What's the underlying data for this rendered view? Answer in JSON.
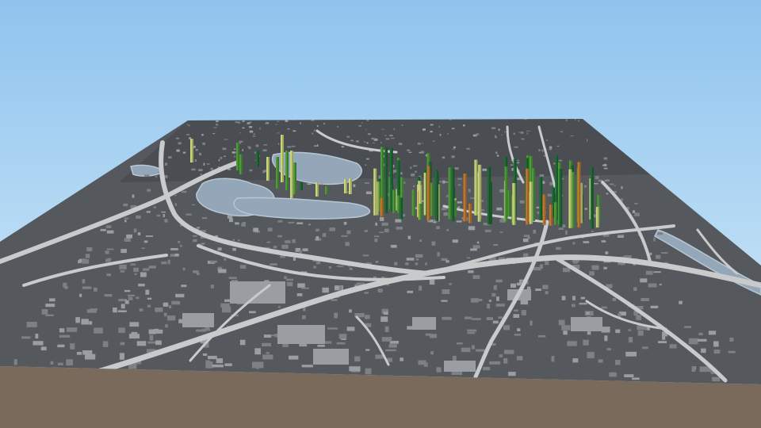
{
  "scene": {
    "colors": {
      "sky_top": "#8fc3ee",
      "sky_bottom": "#d8eef9",
      "ground": "#55595d",
      "ground_dark": "#4a4e52",
      "building": "#7d8185",
      "building_light": "#9a9ea2",
      "road": "#c8cacc",
      "water": "#93a7b8",
      "water_edge": "#b7c6d3",
      "base_edge": "#7a6a5b",
      "bar_dark": "#1e6b35",
      "bar_mid": "#4f9a3a",
      "bar_light": "#c9d67a",
      "bar_orange": "#c8792c"
    },
    "layers": [
      "buildings",
      "roads",
      "water",
      "bars"
    ]
  }
}
